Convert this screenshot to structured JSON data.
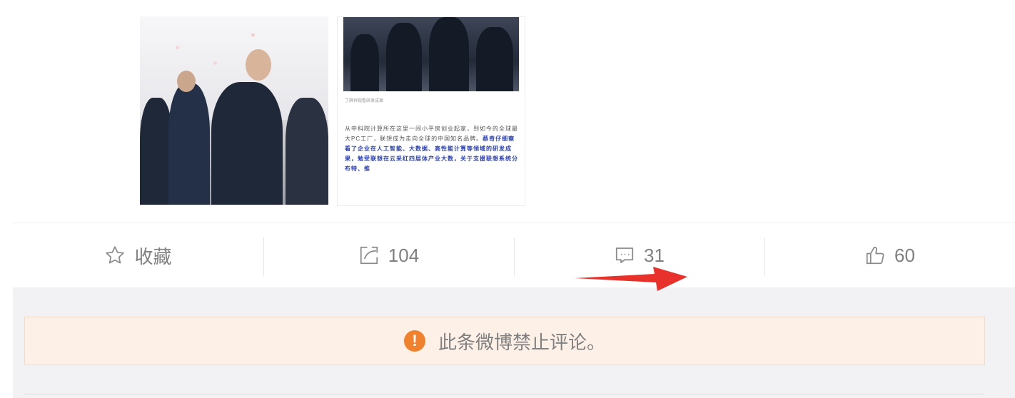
{
  "post": {
    "article": {
      "caption": "丁薛祥观看研发成果",
      "body_plain": "从中科院计算所在这里一间小平房创业起家，到如今的全球最大PC工厂，联想成为走向全球的中国知名品牌。",
      "body_highlight": "蔡奇仔细察看了企业在人工智能、大数据、高性能计算等领域的研发成果，勉受联想在云采红四层体产业大数，关于支援联想系统分布特、推"
    }
  },
  "actions": {
    "favorite": {
      "label": "收藏",
      "icon": "star-icon"
    },
    "repost": {
      "count": "104",
      "icon": "share-icon"
    },
    "comment": {
      "count": "31",
      "icon": "comment-icon"
    },
    "like": {
      "count": "60",
      "icon": "thumbs-up-icon"
    }
  },
  "notice": {
    "text": "此条微博禁止评论。",
    "icon": "warning-icon",
    "icon_glyph": "!"
  },
  "colors": {
    "annotation_arrow": "#e8312a",
    "notice_bg": "#fdf1e7",
    "warning": "#f0822e"
  }
}
